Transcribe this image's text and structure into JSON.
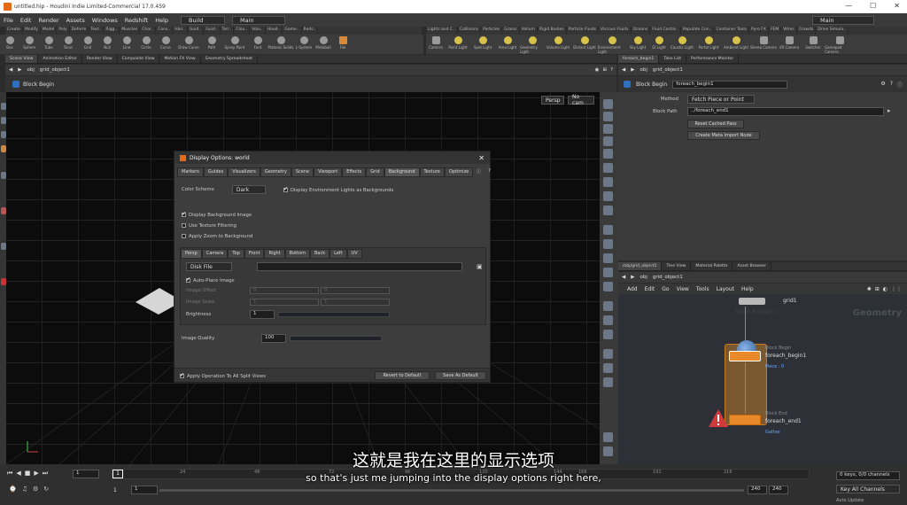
{
  "window": {
    "title": "untitled.hip - Houdini Indie Limited-Commercial 17.0.459"
  },
  "menu": [
    "File",
    "Edit",
    "Render",
    "Assets",
    "Windows",
    "Redshift",
    "Help"
  ],
  "desktop": {
    "build": "Build",
    "main": "Main",
    "main_right": "Main"
  },
  "shelf_tabs_left": [
    "Create",
    "Modify",
    "Model",
    "Poly",
    "Deform",
    "Text..",
    "Rigg..",
    "Muscles",
    "Char..",
    "Cons..",
    "Hair..",
    "Guid..",
    "Guid..",
    "Terr..",
    "Clou..",
    "Volu..",
    "Houd..",
    "Game..",
    "Reds.."
  ],
  "shelf_tabs_right": [
    "Lights and C..",
    "Collisions",
    "Particles",
    "Grains",
    "Vellum",
    "Rigid Bodies",
    "Particle Fluids",
    "Viscous Fluids",
    "Oceans",
    "Fluid Contai..",
    "Populate Con..",
    "Container Tools",
    "Pyro FX",
    "FEM",
    "Wires",
    "Crowds",
    "Drive Simula.."
  ],
  "shelf_tools_left": [
    "Box",
    "Sphere",
    "Tube",
    "Torus",
    "Grid",
    "Null",
    "Line",
    "Circle",
    "Curve",
    "Draw Curve",
    "Path",
    "Spray Paint",
    "Font",
    "Platonic Solids",
    "L-System",
    "Metaball",
    "File"
  ],
  "shelf_tools_right": [
    "Camera",
    "Point Light",
    "Spot Light",
    "Area Light",
    "Geometry Light",
    "Volume Light",
    "Distant Light",
    "Environment Light",
    "Sky Light",
    "GI Light",
    "Caustic Light",
    "Portal Light",
    "Ambient Light",
    "Stereo Camera",
    "VR Camera",
    "Switcher",
    "Gamepad Camera"
  ],
  "left_panel": {
    "tabs": [
      "Scene View",
      "Animation Editor",
      "Render View",
      "Composite View",
      "Motion FX View",
      "Geometry Spreadsheet"
    ],
    "path": [
      "obj",
      "grid_object1"
    ],
    "viewport_title": "Block Begin",
    "persp": "Persp",
    "nocam": "No cam"
  },
  "dialog": {
    "title": "Display Options: world",
    "tabs": [
      "Markers",
      "Guides",
      "Visualizers",
      "Geometry",
      "Scene",
      "Viewport",
      "Effects",
      "Grid",
      "Background",
      "Texture",
      "Optimize"
    ],
    "color_scheme_label": "Color Scheme",
    "color_scheme_value": "Dark",
    "env_lights_label": "Display Environment Lights as Backgrounds",
    "bg_image_label": "Display Background Image",
    "tex_filter_label": "Use Texture Filtering",
    "zoom_bg_label": "Apply Zoom to Background",
    "view_tabs": [
      "Persp",
      "Camera",
      "Top",
      "Front",
      "Right",
      "Bottom",
      "Back",
      "Left",
      "UV"
    ],
    "source_value": "Disk File",
    "auto_place_label": "Auto-Place Image",
    "image_offset_label": "Image Offset",
    "image_scale_label": "Image Scale",
    "offset_vals": [
      "0",
      "0"
    ],
    "scale_vals": [
      "1",
      "1"
    ],
    "brightness_label": "Brightness",
    "brightness_value": "1",
    "image_quality_label": "Image Quality",
    "image_quality_value": "100",
    "apply_split_label": "Apply Operation To All Split Views",
    "revert_label": "Revert to Default",
    "save_label": "Save As Default"
  },
  "right_top": {
    "tabs": [
      "foreach_begin1",
      "Take List",
      "Performance Monitor"
    ],
    "path": [
      "obj",
      "grid_object1"
    ],
    "node_type": "Block Begin",
    "node_name": "foreach_begin1",
    "method_label": "Method",
    "method_value": "Fetch Piece or Point",
    "block_path_label": "Block Path",
    "block_path_value": "../foreach_end1",
    "reset_btn": "Reset Cached Pass",
    "meta_btn": "Create Meta Import Node"
  },
  "right_bottom": {
    "tabs": [
      "/obj/grid_object1",
      "Tree View",
      "Material Palette",
      "Asset Browser"
    ],
    "path": [
      "obj",
      "grid_object1"
    ],
    "menu": [
      "Add",
      "Edit",
      "Go",
      "View",
      "Tools",
      "Layout",
      "Help"
    ],
    "context_label": "Geometry",
    "grid_node": "grid1",
    "input_label": "Indie Edition",
    "begin_type": "Block Begin",
    "begin_name": "foreach_begin1",
    "begin_sub": "Piece : 0",
    "end_type": "Block End",
    "end_name": "foreach_end1",
    "end_sub": "Gather"
  },
  "timeline": {
    "frame": "1",
    "start": "1",
    "start2": "1",
    "ticks": [
      "24",
      "48",
      "72",
      "96",
      "120",
      "144",
      "168",
      "192",
      "216"
    ],
    "end": "240",
    "end2": "240",
    "keys": "0 keys, 0/0 channels",
    "key_all": "Key All Channels",
    "auto_update": "Auto Update"
  },
  "subtitles": {
    "zh": "这就是我在这里的显示选项",
    "en": "so that's just me jumping into the display options right here,"
  }
}
